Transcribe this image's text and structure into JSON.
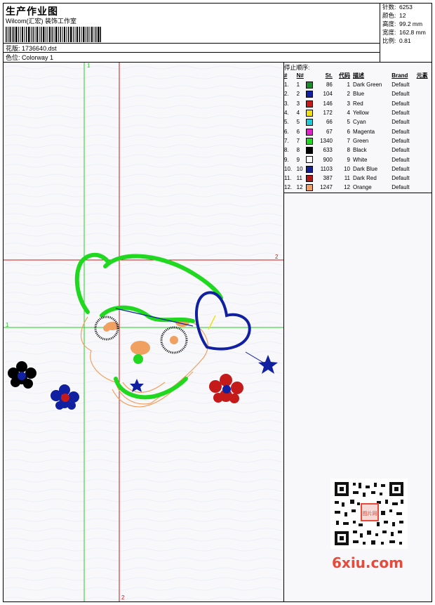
{
  "header": {
    "title": "生产作业图",
    "subtitle": "Wilcom(汇宏) 装饰工作室",
    "design_label": "花版:",
    "design_value": "1736640.dst",
    "colorway_label": "色位:",
    "colorway_value": "Colorway 1"
  },
  "stats": [
    {
      "label": "针数:",
      "value": "6253"
    },
    {
      "label": "颜色:",
      "value": "12"
    },
    {
      "label": "高度:",
      "value": "99.2 mm"
    },
    {
      "label": "宽度:",
      "value": "162.8 mm"
    },
    {
      "label": "比例:",
      "value": "0.81"
    }
  ],
  "stop_sequence": {
    "title": "停止顺序:",
    "headers": {
      "num": "#",
      "n": "N#",
      "st": "St.",
      "code": "代码",
      "desc": "描述",
      "brand": "Brand",
      "element": "元素"
    },
    "rows": [
      {
        "num": "1.",
        "n": "1",
        "color": "#1a8a2a",
        "st": "86",
        "code": "1",
        "desc": "Dark Green",
        "brand": "Default"
      },
      {
        "num": "2.",
        "n": "2",
        "color": "#1020a0",
        "st": "104",
        "code": "2",
        "desc": "Blue",
        "brand": "Default"
      },
      {
        "num": "3.",
        "n": "3",
        "color": "#c41a1a",
        "st": "146",
        "code": "3",
        "desc": "Red",
        "brand": "Default"
      },
      {
        "num": "4.",
        "n": "4",
        "color": "#f0e010",
        "st": "172",
        "code": "4",
        "desc": "Yellow",
        "brand": "Default"
      },
      {
        "num": "5.",
        "n": "5",
        "color": "#20c8d8",
        "st": "66",
        "code": "5",
        "desc": "Cyan",
        "brand": "Default"
      },
      {
        "num": "6.",
        "n": "6",
        "color": "#e020c8",
        "st": "67",
        "code": "6",
        "desc": "Magenta",
        "brand": "Default"
      },
      {
        "num": "7.",
        "n": "7",
        "color": "#20d820",
        "st": "1340",
        "code": "7",
        "desc": "Green",
        "brand": "Default"
      },
      {
        "num": "8.",
        "n": "8",
        "color": "#000000",
        "st": "633",
        "code": "8",
        "desc": "Black",
        "brand": "Default"
      },
      {
        "num": "9.",
        "n": "9",
        "color": "#ffffff",
        "st": "900",
        "code": "9",
        "desc": "White",
        "brand": "Default"
      },
      {
        "num": "10.",
        "n": "10",
        "color": "#102090",
        "st": "1103",
        "code": "10",
        "desc": "Dark Blue",
        "brand": "Default"
      },
      {
        "num": "11.",
        "n": "11",
        "color": "#b01818",
        "st": "387",
        "code": "11",
        "desc": "Dark Red",
        "brand": "Default"
      },
      {
        "num": "12.",
        "n": "12",
        "color": "#f0a060",
        "st": "1247",
        "code": "12",
        "desc": "Orange",
        "brand": "Default"
      }
    ]
  },
  "canvas": {
    "guide_green_color": "#20d020",
    "guide_red_color": "#c81818",
    "marker_green_top": "1",
    "marker_green_left": "1",
    "marker_red_right": "2",
    "marker_red_bottom": "2"
  },
  "watermark": {
    "text": "6xiu.com",
    "stamp_text": "图片网",
    "color": "#e74a3b"
  }
}
